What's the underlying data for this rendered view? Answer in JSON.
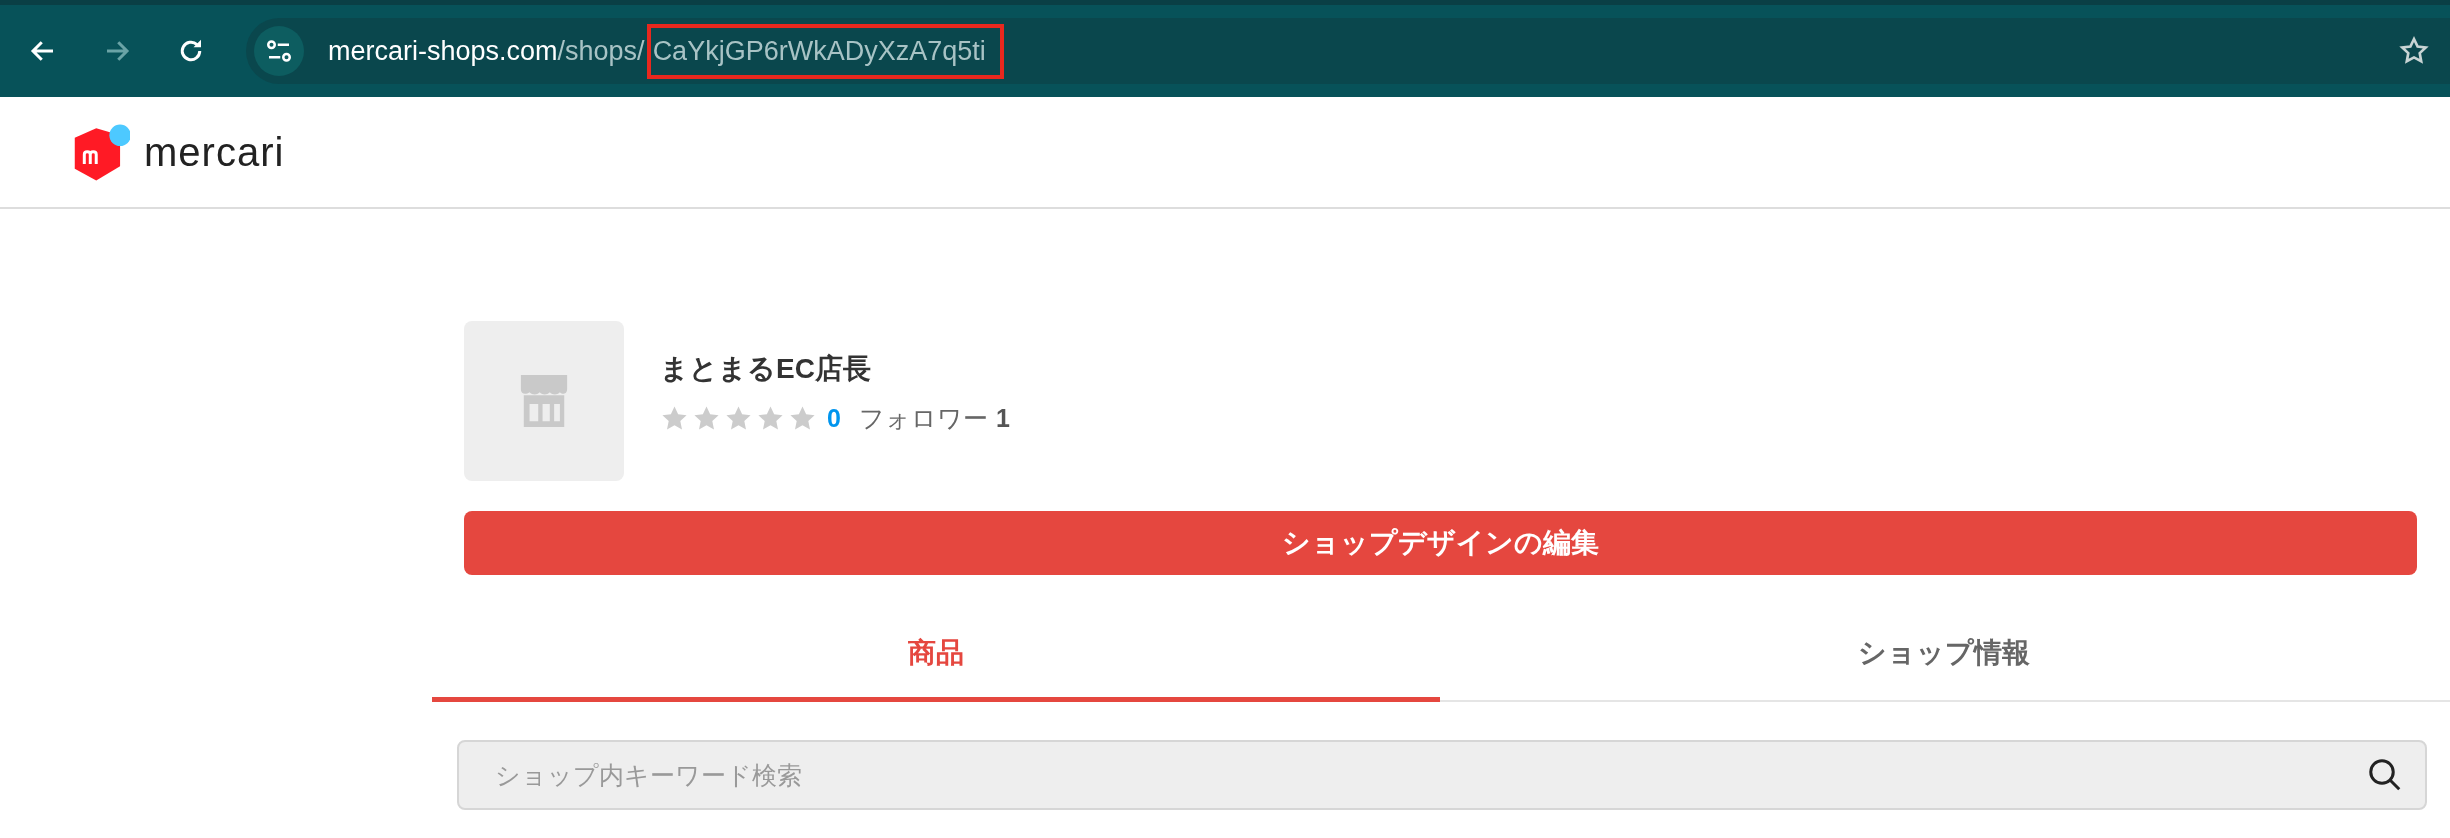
{
  "browser": {
    "url": {
      "host": "mercari-shops.com",
      "path": "/shops/",
      "segment": "CaYkjGP6rWkADyXzA7q5ti",
      "segment_highlighted": true
    },
    "forward_disabled": true
  },
  "header": {
    "logo_text": "mercari"
  },
  "shop": {
    "name": "まとまるEC店長",
    "stars": 0,
    "review_count": "0",
    "follower_label": "フォロワー",
    "follower_count": "1"
  },
  "edit_button": "ショップデザインの編集",
  "tabs": [
    {
      "label": "商品",
      "selected": true
    },
    {
      "label": "ショップ情報",
      "selected": false
    }
  ],
  "search": {
    "placeholder": "ショップ内キーワード検索"
  }
}
